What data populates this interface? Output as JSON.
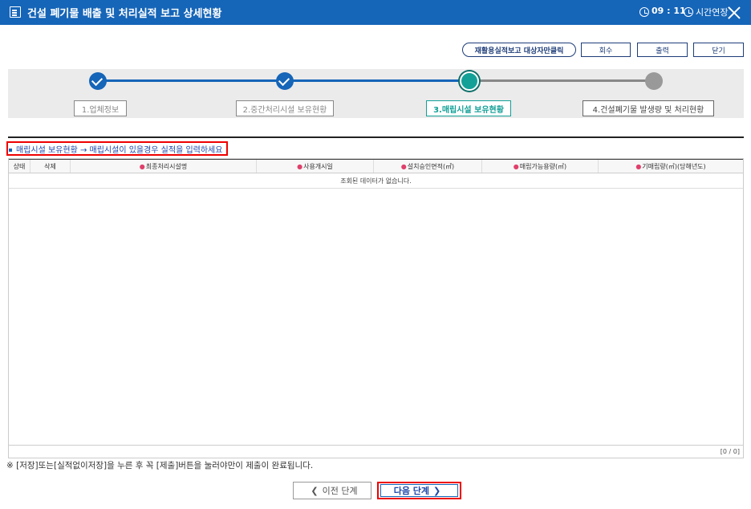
{
  "titlebar": {
    "title": "건설 폐기물 배출 및 처리실적 보고 상세현황",
    "time": "09 : 11",
    "extend_label": "시간연장"
  },
  "toolbar": {
    "recycle_report_label": "재활용실적보고 대상자만클릭",
    "recall_label": "회수",
    "print_label": "출력",
    "close_label": "닫기"
  },
  "steps": [
    {
      "label": "1.업체정보",
      "state": "done"
    },
    {
      "label": "2.중간처리시설 보유현황",
      "state": "done"
    },
    {
      "label": "3.매립시설 보유현황",
      "state": "current"
    },
    {
      "label": "4.건설폐기물 발생량 및 처리현황",
      "state": "todo"
    }
  ],
  "notice": "매립시설 보유현황 → 매립시설이 있을경우 실적을 입력하세요",
  "grid": {
    "columns": [
      {
        "label": "상태",
        "required": false
      },
      {
        "label": "삭제",
        "required": false
      },
      {
        "label": "최종처리시설명",
        "required": true
      },
      {
        "label": "사용개시일",
        "required": true
      },
      {
        "label": "설치승인면적(㎡)",
        "required": true
      },
      {
        "label": "매립가능용량(㎥)",
        "required": true
      },
      {
        "label": "기매립량(㎥)(당해년도)",
        "required": true
      }
    ],
    "required_mark": "●",
    "empty_message": "조회된 데이터가 없습니다.",
    "pager": "[0 / 0]"
  },
  "footnote": "※ [저장]또는[실적없이저장]을 누른 후 꼭 [제출]버튼을 눌러야만이 제출이 완료됩니다.",
  "nav": {
    "prev_label": "이전 단계",
    "next_label": "다음 단계",
    "prev_chevron": "❮",
    "next_chevron": "❯"
  }
}
